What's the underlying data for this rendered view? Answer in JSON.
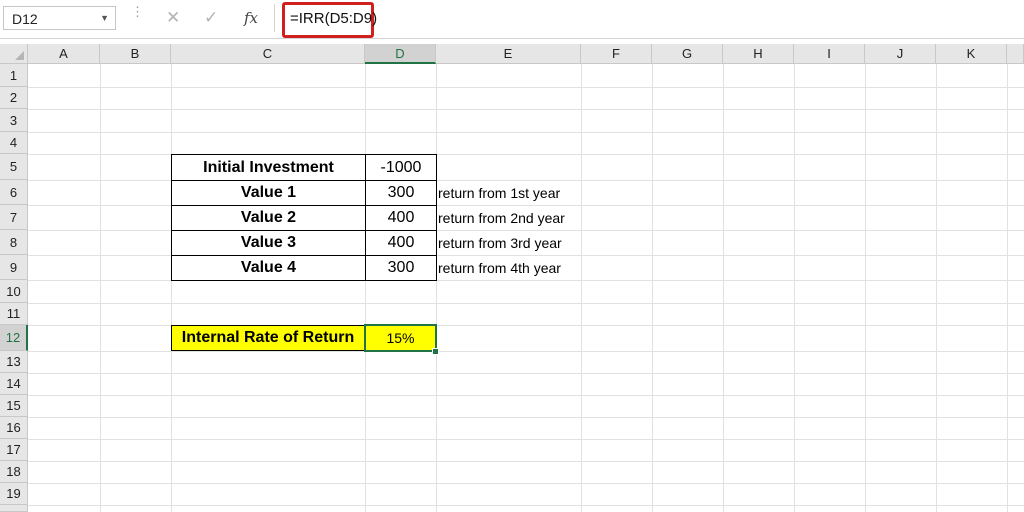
{
  "formula_bar": {
    "name_box": "D12",
    "cancel_icon": "✕",
    "enter_icon": "✓",
    "fx_label": "fx",
    "formula": "=IRR(D5:D9)"
  },
  "columns": [
    "A",
    "B",
    "C",
    "D",
    "E",
    "F",
    "G",
    "H",
    "I",
    "J",
    "K"
  ],
  "rows": [
    "1",
    "2",
    "3",
    "4",
    "5",
    "6",
    "7",
    "8",
    "9",
    "10",
    "11",
    "12",
    "13",
    "14",
    "15",
    "16",
    "17",
    "18",
    "19"
  ],
  "active_cell": {
    "column": "D",
    "row": "12"
  },
  "table": [
    {
      "label": "Initial Investment",
      "value": "-1000",
      "note": ""
    },
    {
      "label": "Value 1",
      "value": "300",
      "note": "return from 1st year"
    },
    {
      "label": "Value 2",
      "value": "400",
      "note": "return from 2nd year"
    },
    {
      "label": "Value 3",
      "value": "400",
      "note": "return from 3rd year"
    },
    {
      "label": "Value 4",
      "value": "300",
      "note": "return from 4th year"
    }
  ],
  "irr": {
    "label": "Internal Rate of Return",
    "value": "15%"
  },
  "colors": {
    "highlight": "#ffff00",
    "formula_outline": "#d01f1f",
    "selection": "#217346"
  },
  "icons": {
    "cancel": "close-icon",
    "enter": "check-icon",
    "function": "fx-icon",
    "dropdown": "chevron-down-icon"
  }
}
